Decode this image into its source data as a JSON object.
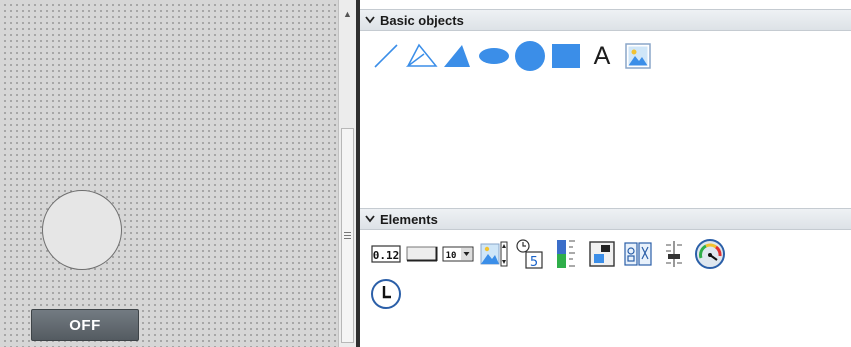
{
  "canvas": {
    "off_button_label": "OFF"
  },
  "sections": {
    "basic_objects": {
      "title": "Basic objects",
      "tools": [
        "line-icon",
        "polyline-icon",
        "polygon-icon",
        "ellipse-icon",
        "circle-icon",
        "rectangle-icon",
        "text-field-icon",
        "graphic-view-icon"
      ],
      "text_tool_label": "A"
    },
    "elements": {
      "title": "Elements",
      "tools": [
        "io-field-icon",
        "button-icon",
        "symbolic-io-field-icon",
        "graphic-io-field-icon",
        "date-time-field-icon",
        "bar-icon",
        "switch-icon",
        "symbol-library-icon",
        "slider-icon",
        "gauge-icon",
        "clock-icon"
      ],
      "io_field_text": "0.12",
      "symbolic_field_text": "10",
      "date_time_text": "5"
    }
  },
  "colors": {
    "shape_blue": "#3b8ee8",
    "splitter": "#2f2f2f",
    "canvas_bg": "#d6d6d6"
  }
}
